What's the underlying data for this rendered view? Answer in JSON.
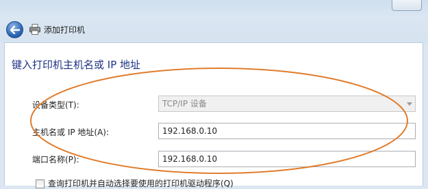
{
  "nav": {
    "title": "添加打印机"
  },
  "main": {
    "heading": "键入打印机主机名或 IP 地址",
    "device_type": {
      "label": "设备类型(T):",
      "value": "TCP/IP 设备"
    },
    "hostname": {
      "label": "主机名或 IP 地址(A):",
      "value": "192.168.0.10"
    },
    "port_name": {
      "label": "端口名称(P):",
      "value": "192.168.0.10"
    },
    "query_checkbox": {
      "label": "查询打印机并自动选择要使用的打印机驱动程序(Q)",
      "checked": false
    }
  },
  "colors": {
    "heading": "#1e3287",
    "annotation": "#e07b2a",
    "back_button": "#2e67b5"
  },
  "icons": {
    "back": "back-arrow-icon",
    "printer": "printer-icon"
  }
}
